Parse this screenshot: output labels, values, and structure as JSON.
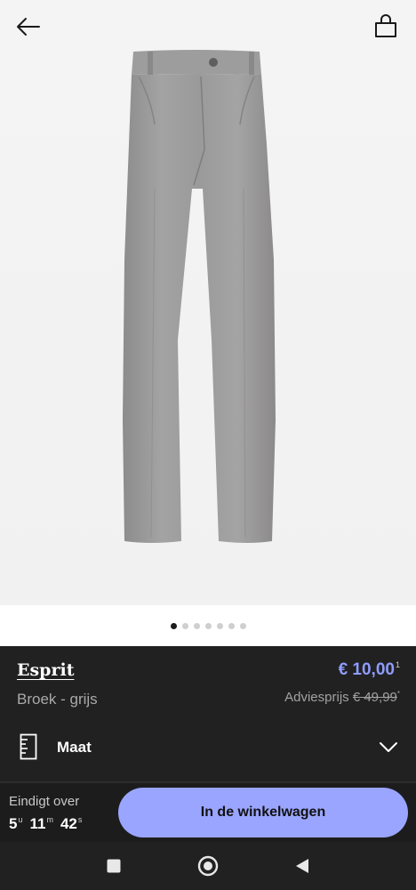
{
  "header": {
    "back_icon": "arrow-left-icon",
    "bag_icon": "shopping-bag-icon"
  },
  "gallery": {
    "image_count": 7,
    "active_index": 0
  },
  "product": {
    "brand": "Esprit",
    "name": "Broek - grijs",
    "price": "€ 10,00",
    "price_note": "1",
    "advice_label": "Adviesprijs",
    "advice_price": "€ 49,99",
    "advice_note": "*"
  },
  "size": {
    "label": "Maat",
    "icon": "ruler-icon"
  },
  "sale": {
    "ends_label": "Eindigt over",
    "hours": "5",
    "hours_unit": "u",
    "minutes": "11",
    "minutes_unit": "m",
    "seconds": "42",
    "seconds_unit": "s"
  },
  "cta": {
    "label": "In de winkelwagen"
  },
  "system_nav": {
    "recent_icon": "square-icon",
    "home_icon": "circle-home-icon",
    "back_icon": "triangle-back-icon"
  },
  "colors": {
    "accent": "#9aa5ff",
    "price": "#8f9cff",
    "panel": "#212121"
  }
}
